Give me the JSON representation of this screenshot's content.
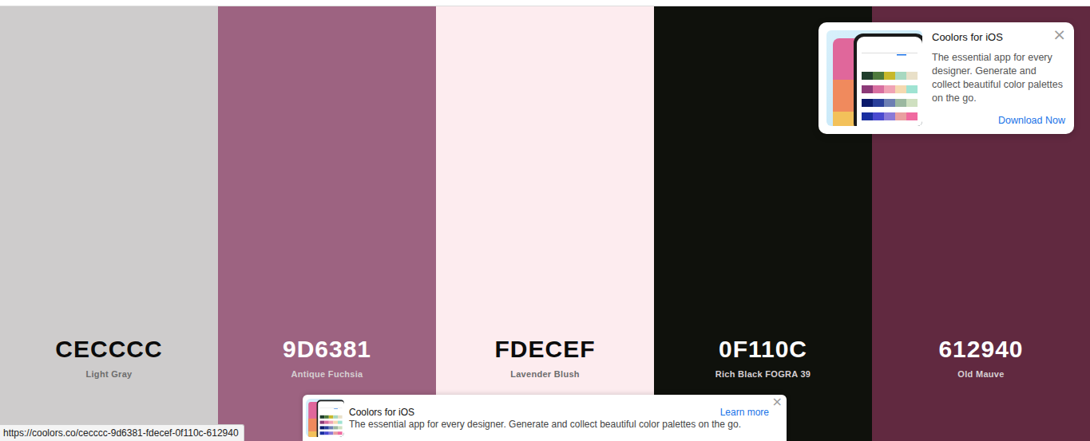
{
  "palette": [
    {
      "hex": "CECCCC",
      "name": "Light Gray",
      "color": "#cecccc"
    },
    {
      "hex": "9D6381",
      "name": "Antique Fuchsia",
      "color": "#9d6381"
    },
    {
      "hex": "FDECEF",
      "name": "Lavender Blush",
      "color": "#fdecef"
    },
    {
      "hex": "0F110C",
      "name": "Rich Black FOGRA 39",
      "color": "#0f110c"
    },
    {
      "hex": "612940",
      "name": "Old Mauve",
      "color": "#612940"
    }
  ],
  "popup": {
    "title": "Coolors for iOS",
    "text": "The essential app for every designer. Generate and collect beautiful color palettes on the go.",
    "link": "Download Now",
    "close": "×"
  },
  "banner": {
    "title": "Coolors for iOS",
    "text": "The essential app for every designer. Generate and collect beautiful color palettes on the go.",
    "link": "Learn more",
    "close": "×"
  },
  "status_bar": {
    "url": "https://coolors.co/cecccc-9d6381-fdecef-0f110c-612940"
  }
}
